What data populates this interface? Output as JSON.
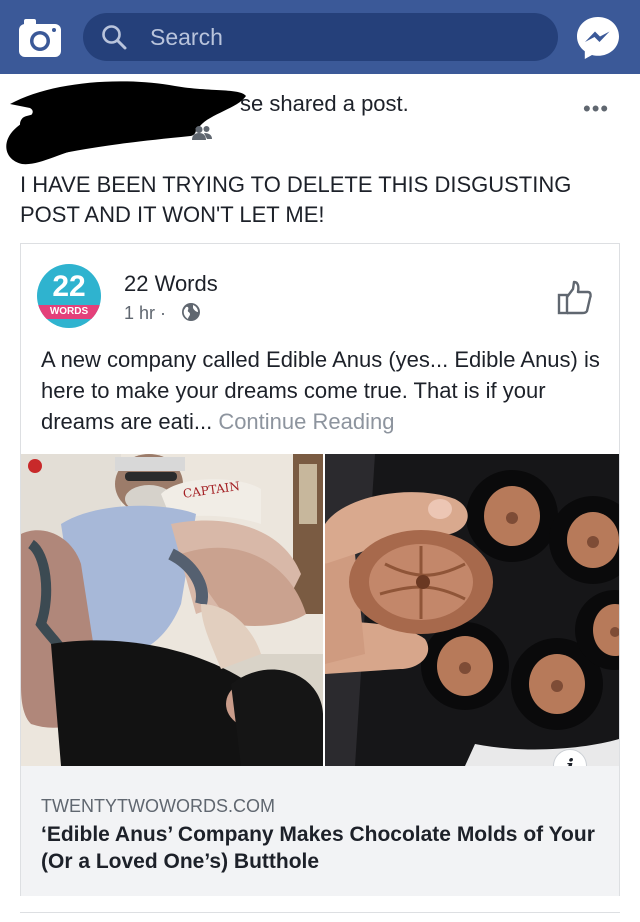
{
  "header": {
    "search_placeholder": "Search",
    "bar_color": "#3b5998",
    "icons": [
      "camera-icon",
      "search-icon",
      "messenger-icon"
    ]
  },
  "post": {
    "shared_text": "se shared a post.",
    "more_label": "•••",
    "text": "I HAVE BEEN TRYING TO DELETE THIS DISGUSTING POST AND IT WON'T LET ME!"
  },
  "shared_post": {
    "logo_number": "22",
    "logo_word": "WORDS",
    "page_name": "22 Words",
    "time": "1 hr ·",
    "body": "A new company called Edible Anus (yes... Edible Anus) is here to make your dreams come true. That is if your dreams are eati...",
    "continue_label": "Continue Reading",
    "photo_sign": "CAPTAIN",
    "info_label": "i",
    "link_domain": "TWENTYTWOWORDS.COM",
    "link_title": "‘Edible Anus’ Company Makes Chocolate Molds of Your (Or a Loved One’s) Butthole"
  }
}
